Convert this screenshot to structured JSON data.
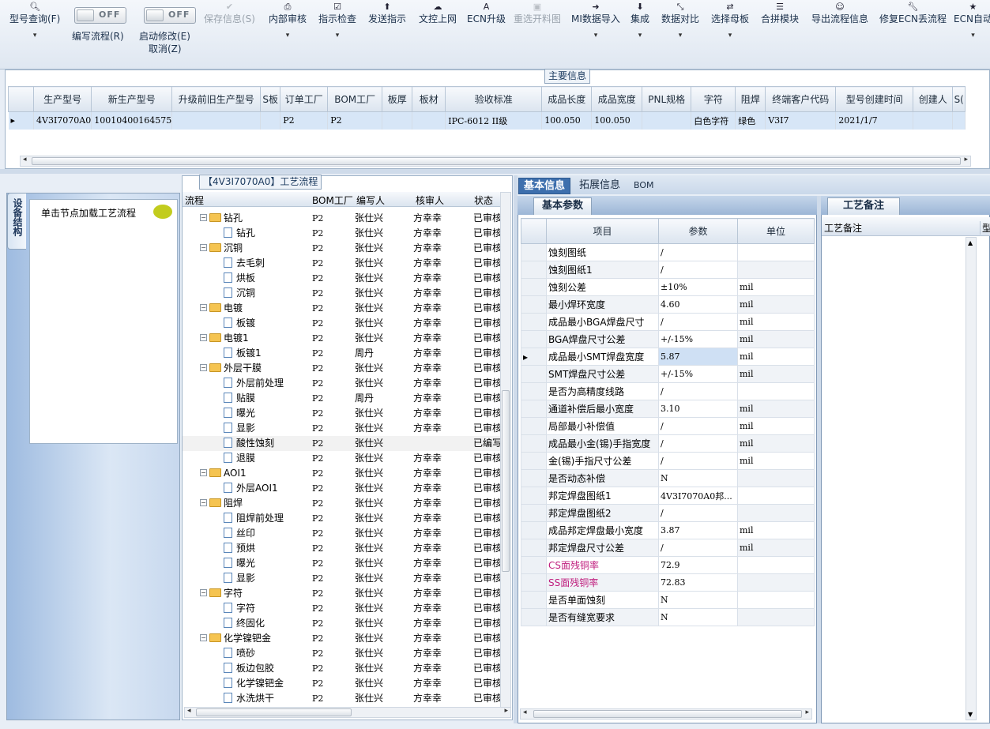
{
  "toolbar": {
    "items": [
      {
        "icon": "search-icon",
        "label": "型号查询(F)",
        "dropdown": true,
        "disabled": false
      },
      {
        "icon": "save-icon",
        "label": "保存信息(S)",
        "dropdown": false,
        "disabled": true
      },
      {
        "icon": "print-icon",
        "label": "内部审核",
        "dropdown": true,
        "disabled": false
      },
      {
        "icon": "check-icon",
        "label": "指示检查",
        "dropdown": true,
        "disabled": false
      },
      {
        "icon": "upload-icon",
        "label": "发送指示",
        "dropdown": false,
        "disabled": false
      },
      {
        "icon": "cloud-upload-icon",
        "label": "文控上网",
        "dropdown": false,
        "disabled": false
      },
      {
        "icon": "font-icon",
        "label": "ECN升级",
        "dropdown": false,
        "disabled": false
      },
      {
        "icon": "image-icon",
        "label": "重选开料图",
        "dropdown": false,
        "disabled": true
      },
      {
        "icon": "login-icon",
        "label": "MI数据导入",
        "dropdown": true,
        "disabled": false
      },
      {
        "icon": "download-icon",
        "label": "集成",
        "dropdown": true,
        "disabled": false
      },
      {
        "icon": "compress-icon",
        "label": "数据对比",
        "dropdown": true,
        "disabled": false
      },
      {
        "icon": "shuffle-icon",
        "label": "选择母板",
        "dropdown": true,
        "disabled": false
      },
      {
        "icon": "list-icon",
        "label": "合拼模块",
        "dropdown": false,
        "disabled": false
      },
      {
        "icon": "smile-icon",
        "label": "导出流程信息",
        "dropdown": false,
        "disabled": false
      },
      {
        "icon": "wrench-icon",
        "label": "修复ECN丢流程",
        "dropdown": false,
        "disabled": false
      },
      {
        "icon": "star-icon",
        "label": "ECN自动",
        "dropdown": true,
        "disabled": false
      }
    ],
    "toggle1": {
      "state": "OFF",
      "label": "编写流程(R)"
    },
    "toggle2": {
      "state": "OFF",
      "label": "启动修改(E)",
      "label2": "取消(Z)"
    }
  },
  "main_info": {
    "caption": "主要信息",
    "columns": [
      "生产型号",
      "新生产型号",
      "升级前旧生产型号",
      "S板",
      "订单工厂",
      "BOM工厂",
      "板厚",
      "板材",
      "验收标准",
      "成品长度",
      "成品宽度",
      "PNL规格",
      "字符",
      "阻焊",
      "终端客户代码",
      "型号创建时间",
      "创建人",
      "S("
    ],
    "row": [
      "4V3I7070A0",
      "10010400164575",
      "",
      "",
      "P2",
      "P2",
      "",
      "",
      "IPC-6012 II级",
      "100.050",
      "100.050",
      "",
      "白色字符",
      "绿色",
      "V3I7",
      "2021/1/7",
      "",
      ""
    ]
  },
  "left_panel": {
    "vertical_tab": "设备结构",
    "node_hint": "单击节点加载工艺流程"
  },
  "process": {
    "caption": "【4V3I7070A0】工艺流程",
    "columns": [
      "流程",
      "BOM工厂",
      "编写人",
      "核审人",
      "状态"
    ],
    "rows": [
      {
        "type": "folder",
        "name": "钻孔",
        "bom": "P2",
        "writer": "张仕兴",
        "reviewer": "方幸幸",
        "status": "已审核"
      },
      {
        "type": "item",
        "name": "钻孔",
        "bom": "P2",
        "writer": "张仕兴",
        "reviewer": "方幸幸",
        "status": "已审核"
      },
      {
        "type": "folder",
        "name": "沉铜",
        "bom": "P2",
        "writer": "张仕兴",
        "reviewer": "方幸幸",
        "status": "已审核"
      },
      {
        "type": "item",
        "name": "去毛刺",
        "bom": "P2",
        "writer": "张仕兴",
        "reviewer": "方幸幸",
        "status": "已审核"
      },
      {
        "type": "item",
        "name": "烘板",
        "bom": "P2",
        "writer": "张仕兴",
        "reviewer": "方幸幸",
        "status": "已审核"
      },
      {
        "type": "item",
        "name": "沉铜",
        "bom": "P2",
        "writer": "张仕兴",
        "reviewer": "方幸幸",
        "status": "已审核"
      },
      {
        "type": "folder",
        "name": "电镀",
        "bom": "P2",
        "writer": "张仕兴",
        "reviewer": "方幸幸",
        "status": "已审核"
      },
      {
        "type": "item",
        "name": "板镀",
        "bom": "P2",
        "writer": "张仕兴",
        "reviewer": "方幸幸",
        "status": "已审核"
      },
      {
        "type": "folder",
        "name": "电镀1",
        "bom": "P2",
        "writer": "张仕兴",
        "reviewer": "方幸幸",
        "status": "已审核"
      },
      {
        "type": "item",
        "name": "板镀1",
        "bom": "P2",
        "writer": "周丹",
        "reviewer": "方幸幸",
        "status": "已审核"
      },
      {
        "type": "folder",
        "name": "外层干膜",
        "bom": "P2",
        "writer": "张仕兴",
        "reviewer": "方幸幸",
        "status": "已审核"
      },
      {
        "type": "item",
        "name": "外层前处理",
        "bom": "P2",
        "writer": "张仕兴",
        "reviewer": "方幸幸",
        "status": "已审核"
      },
      {
        "type": "item",
        "name": "贴膜",
        "bom": "P2",
        "writer": "周丹",
        "reviewer": "方幸幸",
        "status": "已审核"
      },
      {
        "type": "item",
        "name": "曝光",
        "bom": "P2",
        "writer": "张仕兴",
        "reviewer": "方幸幸",
        "status": "已审核"
      },
      {
        "type": "item",
        "name": "显影",
        "bom": "P2",
        "writer": "张仕兴",
        "reviewer": "方幸幸",
        "status": "已审核"
      },
      {
        "type": "item",
        "name": "酸性蚀刻",
        "bom": "P2",
        "writer": "张仕兴",
        "reviewer": "",
        "status": "已编写"
      },
      {
        "type": "item",
        "name": "退膜",
        "bom": "P2",
        "writer": "张仕兴",
        "reviewer": "方幸幸",
        "status": "已审核"
      },
      {
        "type": "folder",
        "name": "AOI1",
        "bom": "P2",
        "writer": "张仕兴",
        "reviewer": "方幸幸",
        "status": "已审核"
      },
      {
        "type": "item",
        "name": "外层AOI1",
        "bom": "P2",
        "writer": "张仕兴",
        "reviewer": "方幸幸",
        "status": "已审核"
      },
      {
        "type": "folder",
        "name": "阻焊",
        "bom": "P2",
        "writer": "张仕兴",
        "reviewer": "方幸幸",
        "status": "已审核"
      },
      {
        "type": "item",
        "name": "阻焊前处理",
        "bom": "P2",
        "writer": "张仕兴",
        "reviewer": "方幸幸",
        "status": "已审核"
      },
      {
        "type": "item",
        "name": "丝印",
        "bom": "P2",
        "writer": "张仕兴",
        "reviewer": "方幸幸",
        "status": "已审核"
      },
      {
        "type": "item",
        "name": "预烘",
        "bom": "P2",
        "writer": "张仕兴",
        "reviewer": "方幸幸",
        "status": "已审核"
      },
      {
        "type": "item",
        "name": "曝光",
        "bom": "P2",
        "writer": "张仕兴",
        "reviewer": "方幸幸",
        "status": "已审核"
      },
      {
        "type": "item",
        "name": "显影",
        "bom": "P2",
        "writer": "张仕兴",
        "reviewer": "方幸幸",
        "status": "已审核"
      },
      {
        "type": "folder",
        "name": "字符",
        "bom": "P2",
        "writer": "张仕兴",
        "reviewer": "方幸幸",
        "status": "已审核"
      },
      {
        "type": "item",
        "name": "字符",
        "bom": "P2",
        "writer": "张仕兴",
        "reviewer": "方幸幸",
        "status": "已审核"
      },
      {
        "type": "item",
        "name": "终固化",
        "bom": "P2",
        "writer": "张仕兴",
        "reviewer": "方幸幸",
        "status": "已审核"
      },
      {
        "type": "folder",
        "name": "化学镍钯金",
        "bom": "P2",
        "writer": "张仕兴",
        "reviewer": "方幸幸",
        "status": "已审核"
      },
      {
        "type": "item",
        "name": "喷砂",
        "bom": "P2",
        "writer": "张仕兴",
        "reviewer": "方幸幸",
        "status": "已审核"
      },
      {
        "type": "item",
        "name": "板边包胶",
        "bom": "P2",
        "writer": "张仕兴",
        "reviewer": "方幸幸",
        "status": "已审核"
      },
      {
        "type": "item",
        "name": "化学镍钯金",
        "bom": "P2",
        "writer": "张仕兴",
        "reviewer": "方幸幸",
        "status": "已审核"
      },
      {
        "type": "item",
        "name": "水洗烘干",
        "bom": "P2",
        "writer": "张仕兴",
        "reviewer": "方幸幸",
        "status": "已审核"
      }
    ]
  },
  "basic": {
    "tabs": [
      "基本信息",
      "拓展信息",
      "BOM"
    ],
    "subtab": "基本参数",
    "columns": [
      "项目",
      "参数",
      "单位"
    ],
    "rows": [
      {
        "item": "蚀刻图纸",
        "value": "/",
        "unit": ""
      },
      {
        "item": "蚀刻图纸1",
        "value": "/",
        "unit": ""
      },
      {
        "item": "蚀刻公差",
        "value": "±10%",
        "unit": "mil"
      },
      {
        "item": "最小焊环宽度",
        "value": "4.60",
        "unit": "mil"
      },
      {
        "item": "成品最小BGA焊盘尺寸",
        "value": "/",
        "unit": "mil"
      },
      {
        "item": "BGA焊盘尺寸公差",
        "value": "+/-15%",
        "unit": "mil"
      },
      {
        "item": "成品最小SMT焊盘宽度",
        "value": "5.87",
        "unit": "mil"
      },
      {
        "item": "SMT焊盘尺寸公差",
        "value": "+/-15%",
        "unit": "mil"
      },
      {
        "item": "是否为高精度线路",
        "value": "/",
        "unit": ""
      },
      {
        "item": "通道补偿后最小宽度",
        "value": "3.10",
        "unit": "mil"
      },
      {
        "item": "局部最小补偿值",
        "value": "/",
        "unit": "mil"
      },
      {
        "item": "成品最小金(锡)手指宽度",
        "value": "/",
        "unit": "mil"
      },
      {
        "item": "金(锡)手指尺寸公差",
        "value": "/",
        "unit": "mil"
      },
      {
        "item": "是否动态补偿",
        "value": "N",
        "unit": ""
      },
      {
        "item": "邦定焊盘图纸1",
        "value": "4V3I7070A0邦...",
        "unit": ""
      },
      {
        "item": "邦定焊盘图纸2",
        "value": "/",
        "unit": ""
      },
      {
        "item": "成品邦定焊盘最小宽度",
        "value": "3.87",
        "unit": "mil"
      },
      {
        "item": "邦定焊盘尺寸公差",
        "value": "/",
        "unit": "mil"
      },
      {
        "item": "CS面残铜率",
        "value": "72.9",
        "unit": ""
      },
      {
        "item": "SS面残铜率",
        "value": "72.83",
        "unit": ""
      },
      {
        "item": "是否单面蚀刻",
        "value": "N",
        "unit": ""
      },
      {
        "item": "是否有缝宽要求",
        "value": "N",
        "unit": ""
      }
    ]
  },
  "notes": {
    "tab": "工艺备注",
    "column": "工艺备注",
    "column2": "型"
  }
}
